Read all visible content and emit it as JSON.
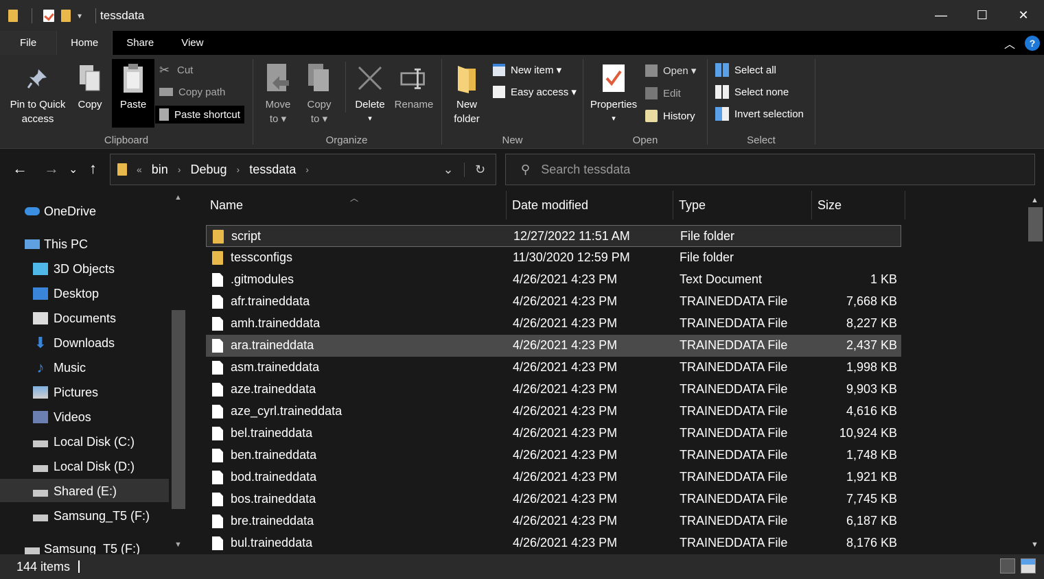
{
  "window": {
    "title": "tessdata"
  },
  "window_controls": {
    "minimize": "—",
    "maximize": "☐",
    "close": "✕"
  },
  "tabs": {
    "file": "File",
    "home": "Home",
    "share": "Share",
    "view": "View"
  },
  "ribbon": {
    "clipboard": {
      "label": "Clipboard",
      "pin_line1": "Pin to Quick",
      "pin_line2": "access",
      "copy": "Copy",
      "paste": "Paste",
      "cut": "Cut",
      "copy_path": "Copy path",
      "paste_shortcut": "Paste shortcut"
    },
    "organize": {
      "label": "Organize",
      "move_line1": "Move",
      "move_line2": "to ▾",
      "copy_line1": "Copy",
      "copy_line2": "to ▾",
      "delete_line1": "Delete",
      "delete_line2": "▾",
      "rename": "Rename"
    },
    "new": {
      "label": "New",
      "folder_line1": "New",
      "folder_line2": "folder",
      "new_item": "New item ▾",
      "easy_access": "Easy access ▾"
    },
    "open": {
      "label": "Open",
      "properties_line1": "Properties",
      "properties_line2": "▾",
      "open": "Open ▾",
      "edit": "Edit",
      "history": "History"
    },
    "select": {
      "label": "Select",
      "select_all": "Select all",
      "select_none": "Select none",
      "invert_selection": "Invert selection"
    }
  },
  "address": {
    "overflow": "«",
    "crumbs": [
      "bin",
      "Debug",
      "tessdata"
    ]
  },
  "search": {
    "placeholder": "Search tessdata"
  },
  "nav_pane": {
    "items": [
      "OneDrive",
      "This PC",
      "3D Objects",
      "Desktop",
      "Documents",
      "Downloads",
      "Music",
      "Pictures",
      "Videos",
      "Local Disk (C:)",
      "Local Disk (D:)",
      "Shared (E:)",
      "Samsung_T5 (F:)",
      "Samsung_T5 (F:)"
    ],
    "selected": "Shared (E:)"
  },
  "columns": {
    "name": "Name",
    "date": "Date modified",
    "type": "Type",
    "size": "Size"
  },
  "files": [
    {
      "name": "script",
      "date": "12/27/2022 11:51 AM",
      "type": "File folder",
      "size": "",
      "kind": "folder"
    },
    {
      "name": "tessconfigs",
      "date": "11/30/2020 12:59 PM",
      "type": "File folder",
      "size": "",
      "kind": "folder"
    },
    {
      "name": ".gitmodules",
      "date": "4/26/2021 4:23 PM",
      "type": "Text Document",
      "size": "1 KB",
      "kind": "txt"
    },
    {
      "name": "afr.traineddata",
      "date": "4/26/2021 4:23 PM",
      "type": "TRAINEDDATA File",
      "size": "7,668 KB",
      "kind": "doc"
    },
    {
      "name": "amh.traineddata",
      "date": "4/26/2021 4:23 PM",
      "type": "TRAINEDDATA File",
      "size": "8,227 KB",
      "kind": "doc"
    },
    {
      "name": "ara.traineddata",
      "date": "4/26/2021 4:23 PM",
      "type": "TRAINEDDATA File",
      "size": "2,437 KB",
      "kind": "doc"
    },
    {
      "name": "asm.traineddata",
      "date": "4/26/2021 4:23 PM",
      "type": "TRAINEDDATA File",
      "size": "1,998 KB",
      "kind": "doc"
    },
    {
      "name": "aze.traineddata",
      "date": "4/26/2021 4:23 PM",
      "type": "TRAINEDDATA File",
      "size": "9,903 KB",
      "kind": "doc"
    },
    {
      "name": "aze_cyrl.traineddata",
      "date": "4/26/2021 4:23 PM",
      "type": "TRAINEDDATA File",
      "size": "4,616 KB",
      "kind": "doc"
    },
    {
      "name": "bel.traineddata",
      "date": "4/26/2021 4:23 PM",
      "type": "TRAINEDDATA File",
      "size": "10,924 KB",
      "kind": "doc"
    },
    {
      "name": "ben.traineddata",
      "date": "4/26/2021 4:23 PM",
      "type": "TRAINEDDATA File",
      "size": "1,748 KB",
      "kind": "doc"
    },
    {
      "name": "bod.traineddata",
      "date": "4/26/2021 4:23 PM",
      "type": "TRAINEDDATA File",
      "size": "1,921 KB",
      "kind": "doc"
    },
    {
      "name": "bos.traineddata",
      "date": "4/26/2021 4:23 PM",
      "type": "TRAINEDDATA File",
      "size": "7,745 KB",
      "kind": "doc"
    },
    {
      "name": "bre.traineddata",
      "date": "4/26/2021 4:23 PM",
      "type": "TRAINEDDATA File",
      "size": "6,187 KB",
      "kind": "doc"
    },
    {
      "name": "bul.traineddata",
      "date": "4/26/2021 4:23 PM",
      "type": "TRAINEDDATA File",
      "size": "8,176 KB",
      "kind": "doc"
    }
  ],
  "selected_row": "script",
  "hovered_row": "ara.traineddata",
  "status": {
    "item_count": "144 items"
  },
  "colors": {
    "background": "#191919",
    "ribbon": "#2b2b2b",
    "tab_bar": "#000000",
    "folder": "#e8b84a",
    "accent": "#1e78d8"
  }
}
